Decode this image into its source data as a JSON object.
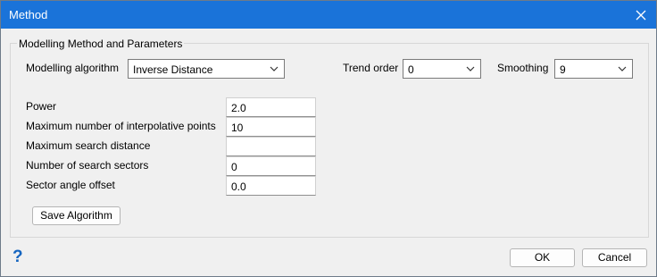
{
  "window": {
    "title": "Method"
  },
  "group": {
    "label": "Modelling Method and Parameters"
  },
  "algorithm": {
    "label": "Modelling algorithm",
    "value": "Inverse Distance"
  },
  "trend_order": {
    "label": "Trend order",
    "value": "0"
  },
  "smoothing": {
    "label": "Smoothing",
    "value": "9"
  },
  "params": [
    {
      "label": "Power",
      "value": "2.0"
    },
    {
      "label": "Maximum number of interpolative points",
      "value": "10"
    },
    {
      "label": "Maximum search distance",
      "value": ""
    },
    {
      "label": "Number of search sectors",
      "value": "0"
    },
    {
      "label": "Sector angle offset",
      "value": "0.0"
    }
  ],
  "buttons": {
    "save_algorithm": "Save Algorithm",
    "ok": "OK",
    "cancel": "Cancel"
  },
  "help": {
    "glyph": "?"
  },
  "colors": {
    "titlebar": "#1a73d9",
    "dialog_bg": "#f0f0f0",
    "help": "#1565c0"
  }
}
